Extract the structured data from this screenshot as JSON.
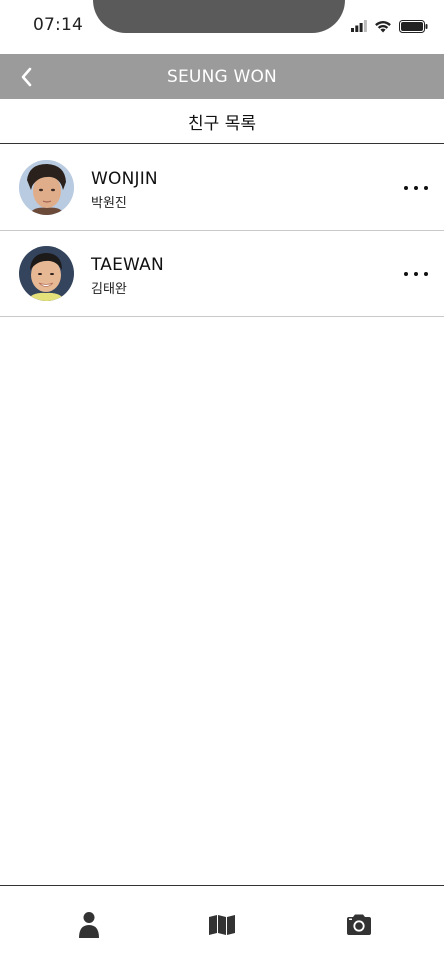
{
  "status_bar": {
    "time": "07:14",
    "icons": [
      "signal-icon",
      "wifi-icon",
      "battery-icon"
    ]
  },
  "header": {
    "title": "SEUNG WON",
    "back_icon": "chevron-left-icon",
    "background": "#9b9b9b"
  },
  "section": {
    "title": "친구 목록"
  },
  "friends": [
    {
      "name": "WONJIN",
      "sub": "박원진"
    },
    {
      "name": "TAEWAN",
      "sub": "김태완"
    }
  ],
  "bottom_nav": {
    "items": [
      "person-icon",
      "map-icon",
      "camera-icon"
    ]
  }
}
